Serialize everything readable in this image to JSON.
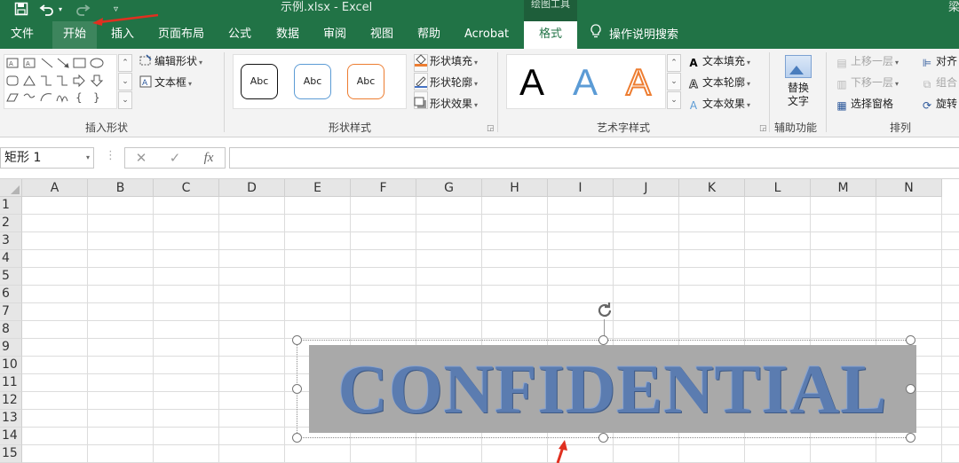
{
  "titlebar": {
    "title": "示例.xlsx  -  Excel",
    "context_group": "绘图工具",
    "user_partial": "梁",
    "icons": [
      "save-icon",
      "undo-icon",
      "redo-icon",
      "customize-qat-icon"
    ]
  },
  "tabs": [
    {
      "label": "文件"
    },
    {
      "label": "开始"
    },
    {
      "label": "插入"
    },
    {
      "label": "页面布局"
    },
    {
      "label": "公式"
    },
    {
      "label": "数据"
    },
    {
      "label": "审阅"
    },
    {
      "label": "视图"
    },
    {
      "label": "帮助"
    },
    {
      "label": "Acrobat"
    },
    {
      "label": "格式"
    }
  ],
  "tell_me": "操作说明搜索",
  "ribbon": {
    "insert_shapes": {
      "label": "插入形状",
      "edit_shape": "编辑形状",
      "text_box": "文本框"
    },
    "shape_styles": {
      "label": "形状样式",
      "sample": "Abc",
      "fill": "形状填充",
      "outline": "形状轮廓",
      "effects": "形状效果"
    },
    "wordart_styles": {
      "label": "艺术字样式",
      "letter": "A",
      "fill": "文本填充",
      "outline": "文本轮廓",
      "effects": "文本效果"
    },
    "accessibility": {
      "label": "辅助功能",
      "alt_text_line1": "替换",
      "alt_text_line2": "文字"
    },
    "arrange": {
      "label": "排列",
      "bring_forward": "上移一层",
      "send_backward": "下移一层",
      "selection_pane": "选择窗格",
      "align": "对齐",
      "group": "组合",
      "rotate": "旋转"
    }
  },
  "formula_bar": {
    "name_box": "矩形 1",
    "cancel": "✕",
    "enter": "✓",
    "fx": "fx",
    "value": ""
  },
  "grid": {
    "columns": [
      "A",
      "B",
      "C",
      "D",
      "E",
      "F",
      "G",
      "H",
      "I",
      "J",
      "K",
      "L",
      "M",
      "N"
    ],
    "rows": [
      "1",
      "2",
      "3",
      "4",
      "5",
      "6",
      "7",
      "8",
      "9",
      "10",
      "11",
      "12",
      "13",
      "14",
      "15"
    ]
  },
  "shape": {
    "text": "CONFIDENTIAL",
    "fill": "#a9a9a9",
    "text_color": "#5b7cb0"
  },
  "colors": {
    "excel_green": "#217346",
    "annotation_red": "#e03020"
  }
}
